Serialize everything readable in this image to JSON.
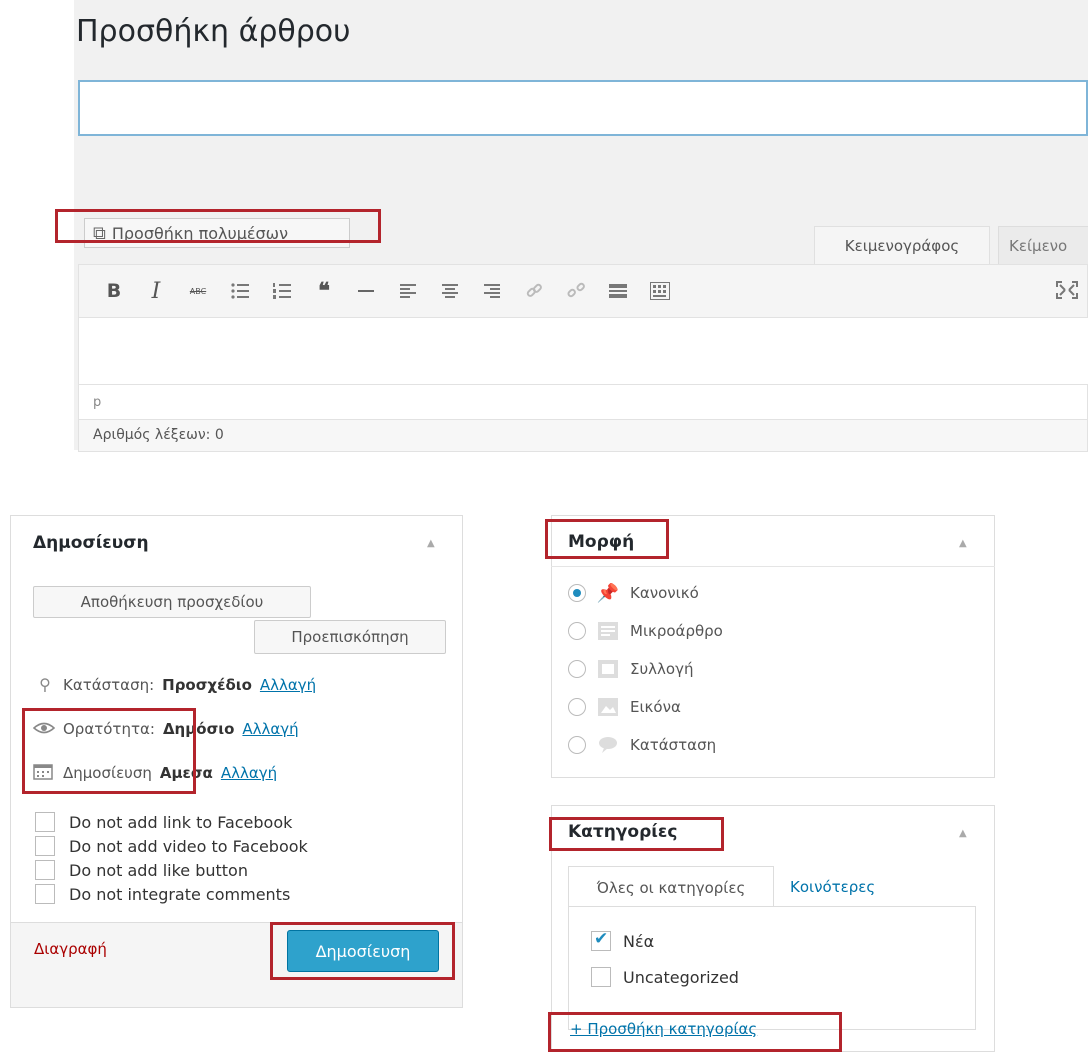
{
  "editor": {
    "title": "Προσθήκη άρθρου",
    "title_placeholder": "",
    "media_button": "Προσθήκη πολυμέσων",
    "tabs": {
      "visual": "Κειμενογράφος",
      "text": "Κείμενο"
    },
    "toolbar": [
      "bold-icon",
      "italic-icon",
      "strikethrough-icon",
      "bullet-list-icon",
      "numbered-list-icon",
      "blockquote-icon",
      "horizontal-rule-icon",
      "align-left-icon",
      "align-center-icon",
      "align-right-icon",
      "link-icon",
      "unlink-icon",
      "read-more-icon",
      "toolbar-toggle-icon"
    ],
    "toolbar_glyphs": {
      "bold": "B",
      "italic": "I",
      "strike": "ABC"
    },
    "path": "p",
    "word_count": "Αριθμός λέξεων: 0"
  },
  "publish": {
    "title": "Δημοσίευση",
    "save_draft": "Αποθήκευση προσχεδίου",
    "preview": "Προεπισκόπηση",
    "status_label": "Κατάσταση:",
    "status_value": "Προσχέδιο",
    "visibility_label": "Ορατότητα:",
    "visibility_value": "Δημόσιο",
    "schedule_label": "Δημοσίευση",
    "schedule_value": "Αμεσα",
    "edit_link": "Αλλαγή",
    "checkboxes": [
      "Do not add link to Facebook",
      "Do not add video to Facebook",
      "Do not add like button",
      "Do not integrate comments"
    ],
    "delete": "Διαγραφή",
    "publish_button": "Δημοσίευση"
  },
  "format": {
    "title": "Μορφή",
    "options": [
      "Κανονικό",
      "Μικροάρθρο",
      "Συλλογή",
      "Εικόνα",
      "Κατάσταση"
    ],
    "selected": "Κανονικό"
  },
  "categories": {
    "title": "Κατηγορίες",
    "tab_all": "Όλες οι κατηγορίες",
    "tab_popular": "Κοινότερες",
    "items": [
      {
        "label": "Νέα",
        "checked": true
      },
      {
        "label": "Uncategorized",
        "checked": false
      }
    ],
    "add_link": "+ Προσθήκη κατηγορίας"
  },
  "colors": {
    "highlight": "#b3242c",
    "primary_button": "#2ea2cc",
    "link": "#0073aa"
  }
}
